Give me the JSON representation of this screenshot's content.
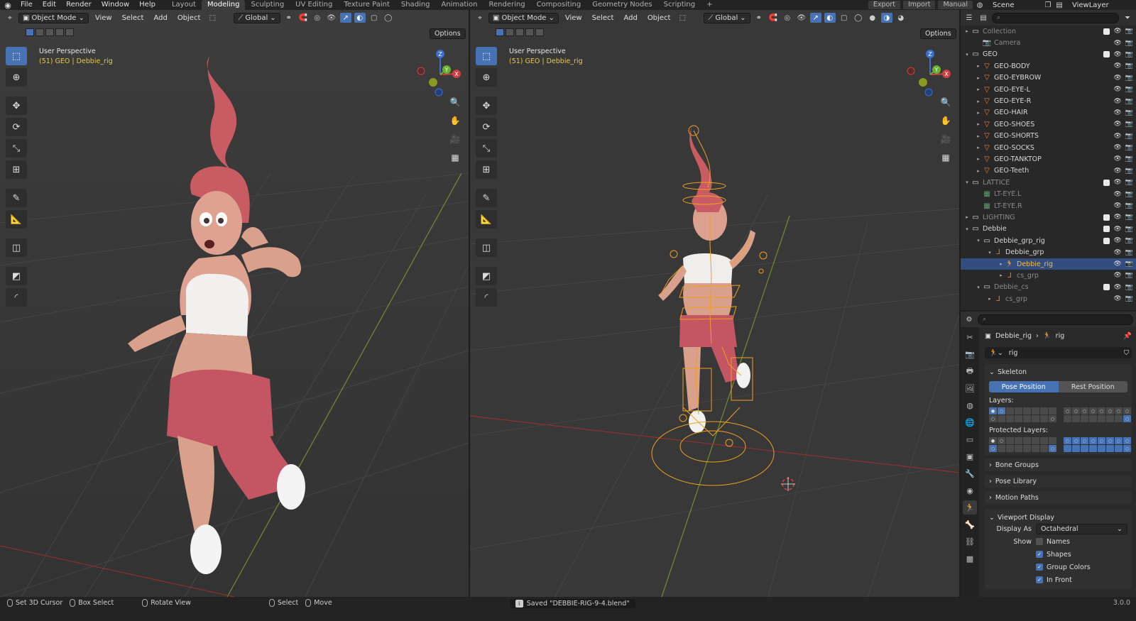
{
  "topbar": {
    "menus": [
      "File",
      "Edit",
      "Render",
      "Window",
      "Help"
    ],
    "workspaces": [
      "Layout",
      "Modeling",
      "Sculpting",
      "UV Editing",
      "Texture Paint",
      "Shading",
      "Animation",
      "Rendering",
      "Compositing",
      "Geometry Nodes",
      "Scripting"
    ],
    "active_workspace": "Modeling",
    "export_label": "Export",
    "import_label": "Import",
    "manual_label": "Manual",
    "scene": "Scene",
    "view_layer": "ViewLayer"
  },
  "viewport_left": {
    "mode": "Object Mode",
    "menus": [
      "View",
      "Select",
      "Add",
      "Object"
    ],
    "transform": "Global",
    "options": "Options",
    "title": "User Perspective",
    "subtitle": "(51) GEO | Debbie_rig"
  },
  "viewport_right": {
    "mode": "Object Mode",
    "menus": [
      "View",
      "Select",
      "Add",
      "Object"
    ],
    "transform": "Global",
    "options": "Options",
    "title": "User Perspective",
    "subtitle": "(51) GEO | Debbie_rig"
  },
  "outliner": {
    "rows": [
      {
        "label": "Collection",
        "depth": 0,
        "icon": "collection-icon",
        "dim": true,
        "tri": "▸"
      },
      {
        "label": "Camera",
        "depth": 1,
        "icon": "camera-icon",
        "dim": true,
        "tri": ""
      },
      {
        "label": "GEO",
        "depth": 0,
        "icon": "collection-icon",
        "dim": false,
        "tri": "▾"
      },
      {
        "label": "GEO-BODY",
        "depth": 1,
        "icon": "mesh-icon",
        "dim": false,
        "tri": "▸"
      },
      {
        "label": "GEO-EYBROW",
        "depth": 1,
        "icon": "mesh-icon",
        "dim": false,
        "tri": "▸"
      },
      {
        "label": "GEO-EYE-L",
        "depth": 1,
        "icon": "mesh-icon",
        "dim": false,
        "tri": "▸"
      },
      {
        "label": "GEO-EYE-R",
        "depth": 1,
        "icon": "mesh-icon",
        "dim": false,
        "tri": "▸"
      },
      {
        "label": "GEO-HAIR",
        "depth": 1,
        "icon": "mesh-icon",
        "dim": false,
        "tri": "▸"
      },
      {
        "label": "GEO-SHOES",
        "depth": 1,
        "icon": "mesh-icon",
        "dim": false,
        "tri": "▸"
      },
      {
        "label": "GEO-SHORTS",
        "depth": 1,
        "icon": "mesh-icon",
        "dim": false,
        "tri": "▸"
      },
      {
        "label": "GEO-SOCKS",
        "depth": 1,
        "icon": "mesh-icon",
        "dim": false,
        "tri": "▸"
      },
      {
        "label": "GEO-TANKTOP",
        "depth": 1,
        "icon": "mesh-icon",
        "dim": false,
        "tri": "▸"
      },
      {
        "label": "GEO-Teeth",
        "depth": 1,
        "icon": "mesh-icon",
        "dim": false,
        "tri": "▸"
      },
      {
        "label": "LATTICE",
        "depth": 0,
        "icon": "collection-icon",
        "dim": true,
        "tri": "▾"
      },
      {
        "label": "LT-EYE.L",
        "depth": 1,
        "icon": "lattice-icon",
        "dim": true,
        "tri": ""
      },
      {
        "label": "LT-EYE.R",
        "depth": 1,
        "icon": "lattice-icon",
        "dim": true,
        "tri": ""
      },
      {
        "label": "LIGHTING",
        "depth": 0,
        "icon": "collection-icon",
        "dim": true,
        "tri": "▸"
      },
      {
        "label": "Debbie",
        "depth": 0,
        "icon": "collection-icon",
        "dim": false,
        "tri": "▾"
      },
      {
        "label": "Debbie_grp_rig",
        "depth": 1,
        "icon": "collection-icon",
        "dim": false,
        "tri": "▾"
      },
      {
        "label": "Debbie_grp",
        "depth": 2,
        "icon": "empty-icon",
        "dim": false,
        "tri": "▾"
      },
      {
        "label": "Debbie_rig",
        "depth": 3,
        "icon": "armature-icon",
        "dim": false,
        "tri": "▸",
        "selected": true
      },
      {
        "label": "cs_grp",
        "depth": 3,
        "icon": "empty-icon",
        "dim": true,
        "tri": "▸"
      },
      {
        "label": "Debbie_cs",
        "depth": 1,
        "icon": "collection-icon",
        "dim": true,
        "tri": "▾"
      },
      {
        "label": "cs_grp",
        "depth": 2,
        "icon": "empty-icon",
        "dim": true,
        "tri": "▸"
      }
    ]
  },
  "properties": {
    "breadcrumb_object": "Debbie_rig",
    "breadcrumb_data": "rig",
    "data_name": "rig",
    "skeleton": {
      "title": "Skeleton",
      "pose_position": "Pose Position",
      "rest_position": "Rest Position",
      "layers_label": "Layers:",
      "protected_label": "Protected Layers:"
    },
    "collapsed_panels": [
      "Bone Groups",
      "Pose Library",
      "Motion Paths"
    ],
    "viewport_display": {
      "title": "Viewport Display",
      "display_as_label": "Display As",
      "display_as_value": "Octahedral",
      "show_label": "Show",
      "options": [
        {
          "label": "Names",
          "checked": false
        },
        {
          "label": "Shapes",
          "checked": true
        },
        {
          "label": "Group Colors",
          "checked": true
        },
        {
          "label": "In Front",
          "checked": true
        }
      ]
    }
  },
  "statusbar": {
    "set_cursor": "Set 3D Cursor",
    "box_select": "Box Select",
    "rotate_view": "Rotate View",
    "select": "Select",
    "move": "Move",
    "saved_message": "Saved \"DEBBIE-RIG-9-4.blend\"",
    "version": "3.0.0"
  }
}
